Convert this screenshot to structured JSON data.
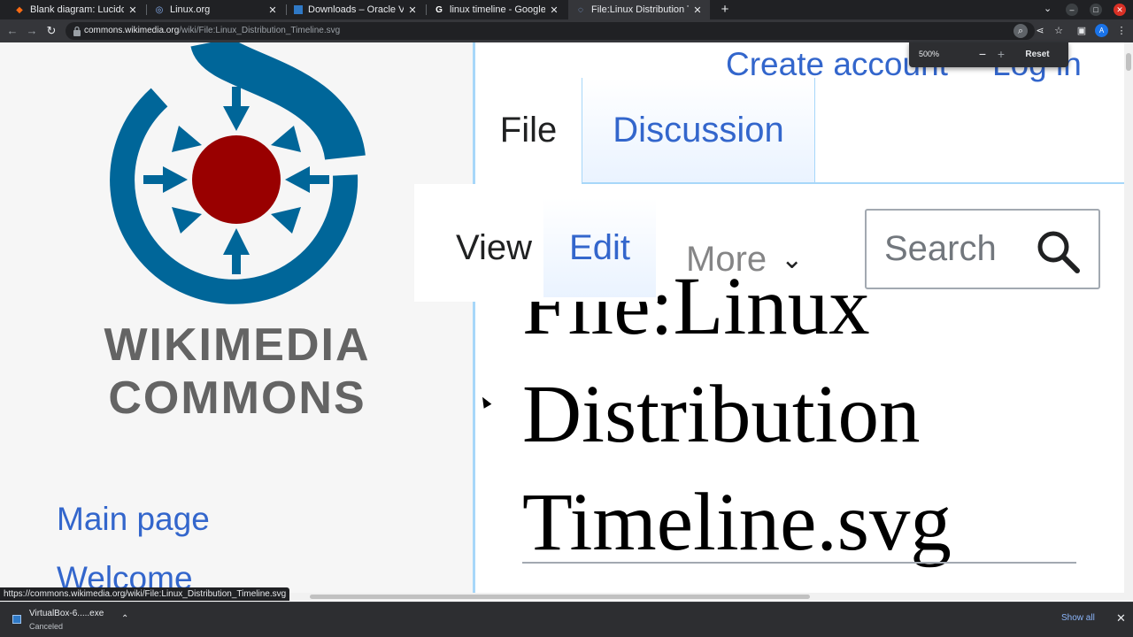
{
  "browser": {
    "tabs": [
      {
        "title": "Blank diagram: Lucidchar",
        "favicon": "lucid-icon"
      },
      {
        "title": "Linux.org",
        "favicon": "linux-org-icon"
      },
      {
        "title": "Downloads – Oracle VM V",
        "favicon": "virtualbox-icon"
      },
      {
        "title": "linux timeline - Google cy",
        "favicon": "google-icon"
      },
      {
        "title": "File:Linux Distribution Ti",
        "favicon": "wikimedia-icon",
        "active": true
      }
    ],
    "url_host": "commons.wikimedia.org",
    "url_path": "/wiki/File:Linux_Distribution_Timeline.svg",
    "profile_initial": "A"
  },
  "zoom": {
    "level": "500%",
    "minus": "−",
    "plus": "+",
    "reset_label": "Reset"
  },
  "wiki": {
    "logo_line1": "WIKIMEDIA",
    "logo_line2": "COMMONS",
    "sidebar_links": [
      "Main page",
      "Welcome"
    ],
    "personal": {
      "create_account": "Create account",
      "log_in": "Log in"
    },
    "namespace_tabs": {
      "file": "File",
      "discussion": "Discussion"
    },
    "view_tabs": {
      "view": "View",
      "edit": "Edit",
      "more": "More"
    },
    "search_placeholder": "Search",
    "heading_lines": [
      "File:Linux",
      "Distribution",
      "Timeline.svg"
    ],
    "colors": {
      "link": "#3366cc",
      "logo_blue": "#006699",
      "logo_red": "#990000",
      "border": "#a7d7f9"
    }
  },
  "status_bar_url": "https://commons.wikimedia.org/wiki/File:Linux_Distribution_Timeline.svg",
  "downloads": {
    "file_name": "VirtualBox-6.....exe",
    "status": "Canceled",
    "show_all": "Show all"
  }
}
